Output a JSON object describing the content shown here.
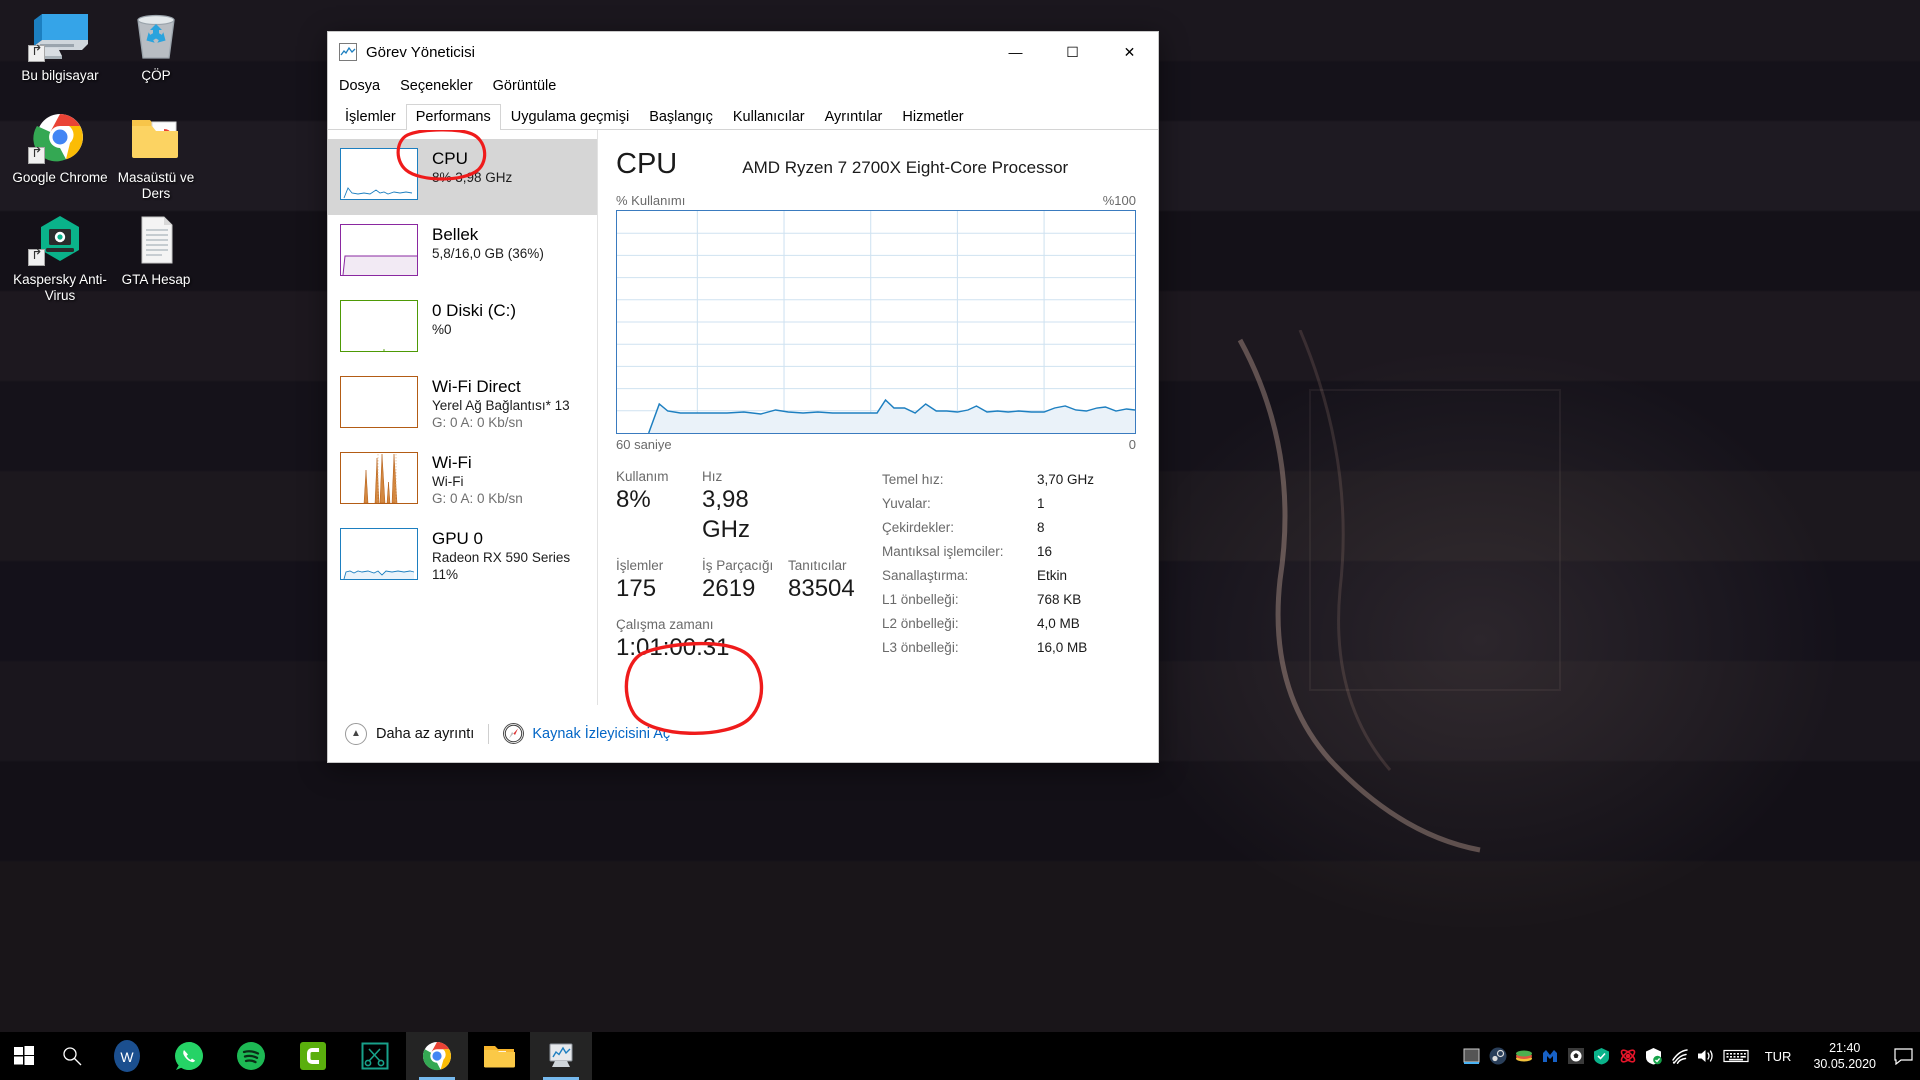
{
  "desktop": {
    "icons": [
      {
        "name": "this-pc",
        "label": "Bu bilgisayar",
        "icon": "monitor-icon",
        "shortcut": true
      },
      {
        "name": "recycle-bin",
        "label": "ÇÖP",
        "icon": "recycle-bin-icon",
        "shortcut": false
      },
      {
        "name": "google-chrome",
        "label": "Google Chrome",
        "icon": "chrome-icon",
        "shortcut": true
      },
      {
        "name": "desktop-and-lesson-folder",
        "label": "Masaüstü ve Ders",
        "icon": "folder-icon",
        "shortcut": false
      },
      {
        "name": "kaspersky",
        "label": "Kaspersky Anti-Virus",
        "icon": "kaspersky-icon",
        "shortcut": true
      },
      {
        "name": "gta-hesap",
        "label": "GTA Hesap",
        "icon": "text-file-icon",
        "shortcut": false
      }
    ]
  },
  "taskbar": {
    "start": "start-icon",
    "search": "search-icon",
    "apps": [
      {
        "name": "wattpad",
        "icon": "wattpad-icon",
        "active": false
      },
      {
        "name": "whatsapp",
        "icon": "whatsapp-icon",
        "active": false
      },
      {
        "name": "spotify",
        "icon": "spotify-icon",
        "active": false
      },
      {
        "name": "camtasia",
        "icon": "camtasia-icon",
        "active": false
      },
      {
        "name": "snipping-tool",
        "icon": "snip-icon",
        "active": false
      },
      {
        "name": "google-chrome",
        "icon": "chrome-icon",
        "active": true
      },
      {
        "name": "file-explorer",
        "icon": "folder-icon",
        "active": false
      },
      {
        "name": "task-manager",
        "icon": "task-manager-icon",
        "active": true
      }
    ],
    "tray": [
      {
        "name": "tray-nvidia",
        "icon": "grid-icon"
      },
      {
        "name": "tray-steam",
        "icon": "steam-icon"
      },
      {
        "name": "tray-books",
        "icon": "books-icon"
      },
      {
        "name": "tray-malwarebytes",
        "icon": "malwarebytes-icon"
      },
      {
        "name": "tray-soccer",
        "icon": "soccer-icon"
      },
      {
        "name": "tray-kaspersky",
        "icon": "shield-green-icon"
      },
      {
        "name": "tray-red",
        "icon": "red-atom-icon"
      },
      {
        "name": "tray-defender",
        "icon": "defender-shield-icon"
      },
      {
        "name": "tray-network",
        "icon": "wifi-icon"
      },
      {
        "name": "tray-volume",
        "icon": "speaker-icon"
      },
      {
        "name": "tray-keyboard",
        "icon": "keyboard-icon"
      }
    ],
    "language": "TUR",
    "clock_time": "21:40",
    "clock_date": "30.05.2020",
    "action_center": "action-center-icon"
  },
  "window": {
    "title": "Görev Yöneticisi",
    "icon": "task-manager-icon",
    "controls": {
      "minimize": "—",
      "maximize": "☐",
      "close": "✕"
    },
    "menu": [
      "Dosya",
      "Seçenekler",
      "Görüntüle"
    ],
    "tabs": [
      {
        "label": "İşlemler",
        "active": false
      },
      {
        "label": "Performans",
        "active": true
      },
      {
        "label": "Uygulama geçmişi",
        "active": false
      },
      {
        "label": "Başlangıç",
        "active": false
      },
      {
        "label": "Kullanıcılar",
        "active": false
      },
      {
        "label": "Ayrıntılar",
        "active": false
      },
      {
        "label": "Hizmetler",
        "active": false
      }
    ]
  },
  "sidebar": {
    "items": [
      {
        "name": "cpu",
        "title": "CPU",
        "sub1": "8%  3,98 GHz",
        "sub2": "",
        "color": "#1d7fc0",
        "selected": true,
        "graph": "cpu"
      },
      {
        "name": "memory",
        "title": "Bellek",
        "sub1": "5,8/16,0 GB (36%)",
        "sub2": "",
        "color": "#8a28a0",
        "selected": false,
        "graph": "memory"
      },
      {
        "name": "disk-0",
        "title": "0 Diski (C:)",
        "sub1": "%0",
        "sub2": "",
        "color": "#4e9a06",
        "selected": false,
        "graph": "disk"
      },
      {
        "name": "wifi-direct",
        "title": "Wi-Fi Direct",
        "sub1": "Yerel Ağ Bağlantısı* 13",
        "sub2": "G: 0 A: 0 Kb/sn",
        "color": "#b35c15",
        "selected": false,
        "graph": "flat"
      },
      {
        "name": "wifi",
        "title": "Wi-Fi",
        "sub1": "Wi-Fi",
        "sub2": "G: 0 A: 0 Kb/sn",
        "color": "#b35c15",
        "selected": false,
        "graph": "spikes"
      },
      {
        "name": "gpu-0",
        "title": "GPU 0",
        "sub1": "Radeon RX 590 Series",
        "sub2": "11%",
        "color": "#1d7fc0",
        "selected": false,
        "graph": "gpu"
      }
    ]
  },
  "main": {
    "heading": "CPU",
    "model": "AMD Ryzen 7 2700X Eight-Core Processor",
    "graph_label_left": "% Kullanımı",
    "graph_label_right": "%100",
    "graph_foot_left": "60 saniye",
    "graph_foot_right": "0",
    "stats": [
      {
        "label": "Kullanım",
        "value": "8%"
      },
      {
        "label": "Hız",
        "value": "3,98 GHz"
      },
      {
        "label": "İşlemler",
        "value": "175"
      },
      {
        "label": "İş Parçacığı",
        "value": "2619"
      },
      {
        "label": "Tanıtıcılar",
        "value": "83504"
      },
      {
        "label": "Çalışma zamanı",
        "value": "1:01:00:31"
      }
    ],
    "specs": [
      {
        "key": "Temel hız:",
        "value": "3,70 GHz"
      },
      {
        "key": "Yuvalar:",
        "value": "1"
      },
      {
        "key": "Çekirdekler:",
        "value": "8"
      },
      {
        "key": "Mantıksal işlemciler:",
        "value": "16"
      },
      {
        "key": "Sanallaştırma:",
        "value": "Etkin"
      },
      {
        "key": "L1 önbelleği:",
        "value": "768 KB"
      },
      {
        "key": "L2 önbelleği:",
        "value": "4,0 MB"
      },
      {
        "key": "L3 önbelleği:",
        "value": "16,0 MB"
      }
    ]
  },
  "footer": {
    "less_details": "Daha az ayrıntı",
    "less_details_icon": "chevron-up-icon",
    "resource_monitor": "Kaynak İzleyicisini Aç",
    "resource_monitor_icon": "resource-monitor-icon"
  },
  "annotations": {
    "color": "#ef1b1b",
    "marks": [
      {
        "name": "performans-tab-circle",
        "target": "Performans"
      },
      {
        "name": "uptime-circle",
        "target": "Çalışma zamanı 1:01:00:31"
      }
    ]
  },
  "chart_data": {
    "type": "area",
    "title": "% Kullanımı",
    "ylabel": "% Kullanımı",
    "xlabel": "60 saniye",
    "ylim": [
      0,
      100
    ],
    "xlim": [
      60,
      0
    ],
    "grid": true,
    "legend": "none",
    "line_color": "#1d7fc0",
    "fill_color": "#e8f1f9",
    "series": [
      {
        "name": "CPU % Kullanımı",
        "values": [
          0,
          13,
          10,
          7,
          6,
          6,
          6,
          6,
          6,
          5,
          5,
          6,
          5,
          6,
          7,
          6,
          6,
          6,
          6,
          6,
          6,
          6,
          6,
          14,
          8,
          8,
          6,
          11,
          6,
          7,
          7,
          7,
          7,
          10,
          6,
          7,
          7,
          7,
          7,
          7,
          7,
          7,
          7,
          9,
          10,
          8,
          7,
          8,
          9,
          9,
          8,
          7,
          8,
          8
        ]
      }
    ]
  }
}
